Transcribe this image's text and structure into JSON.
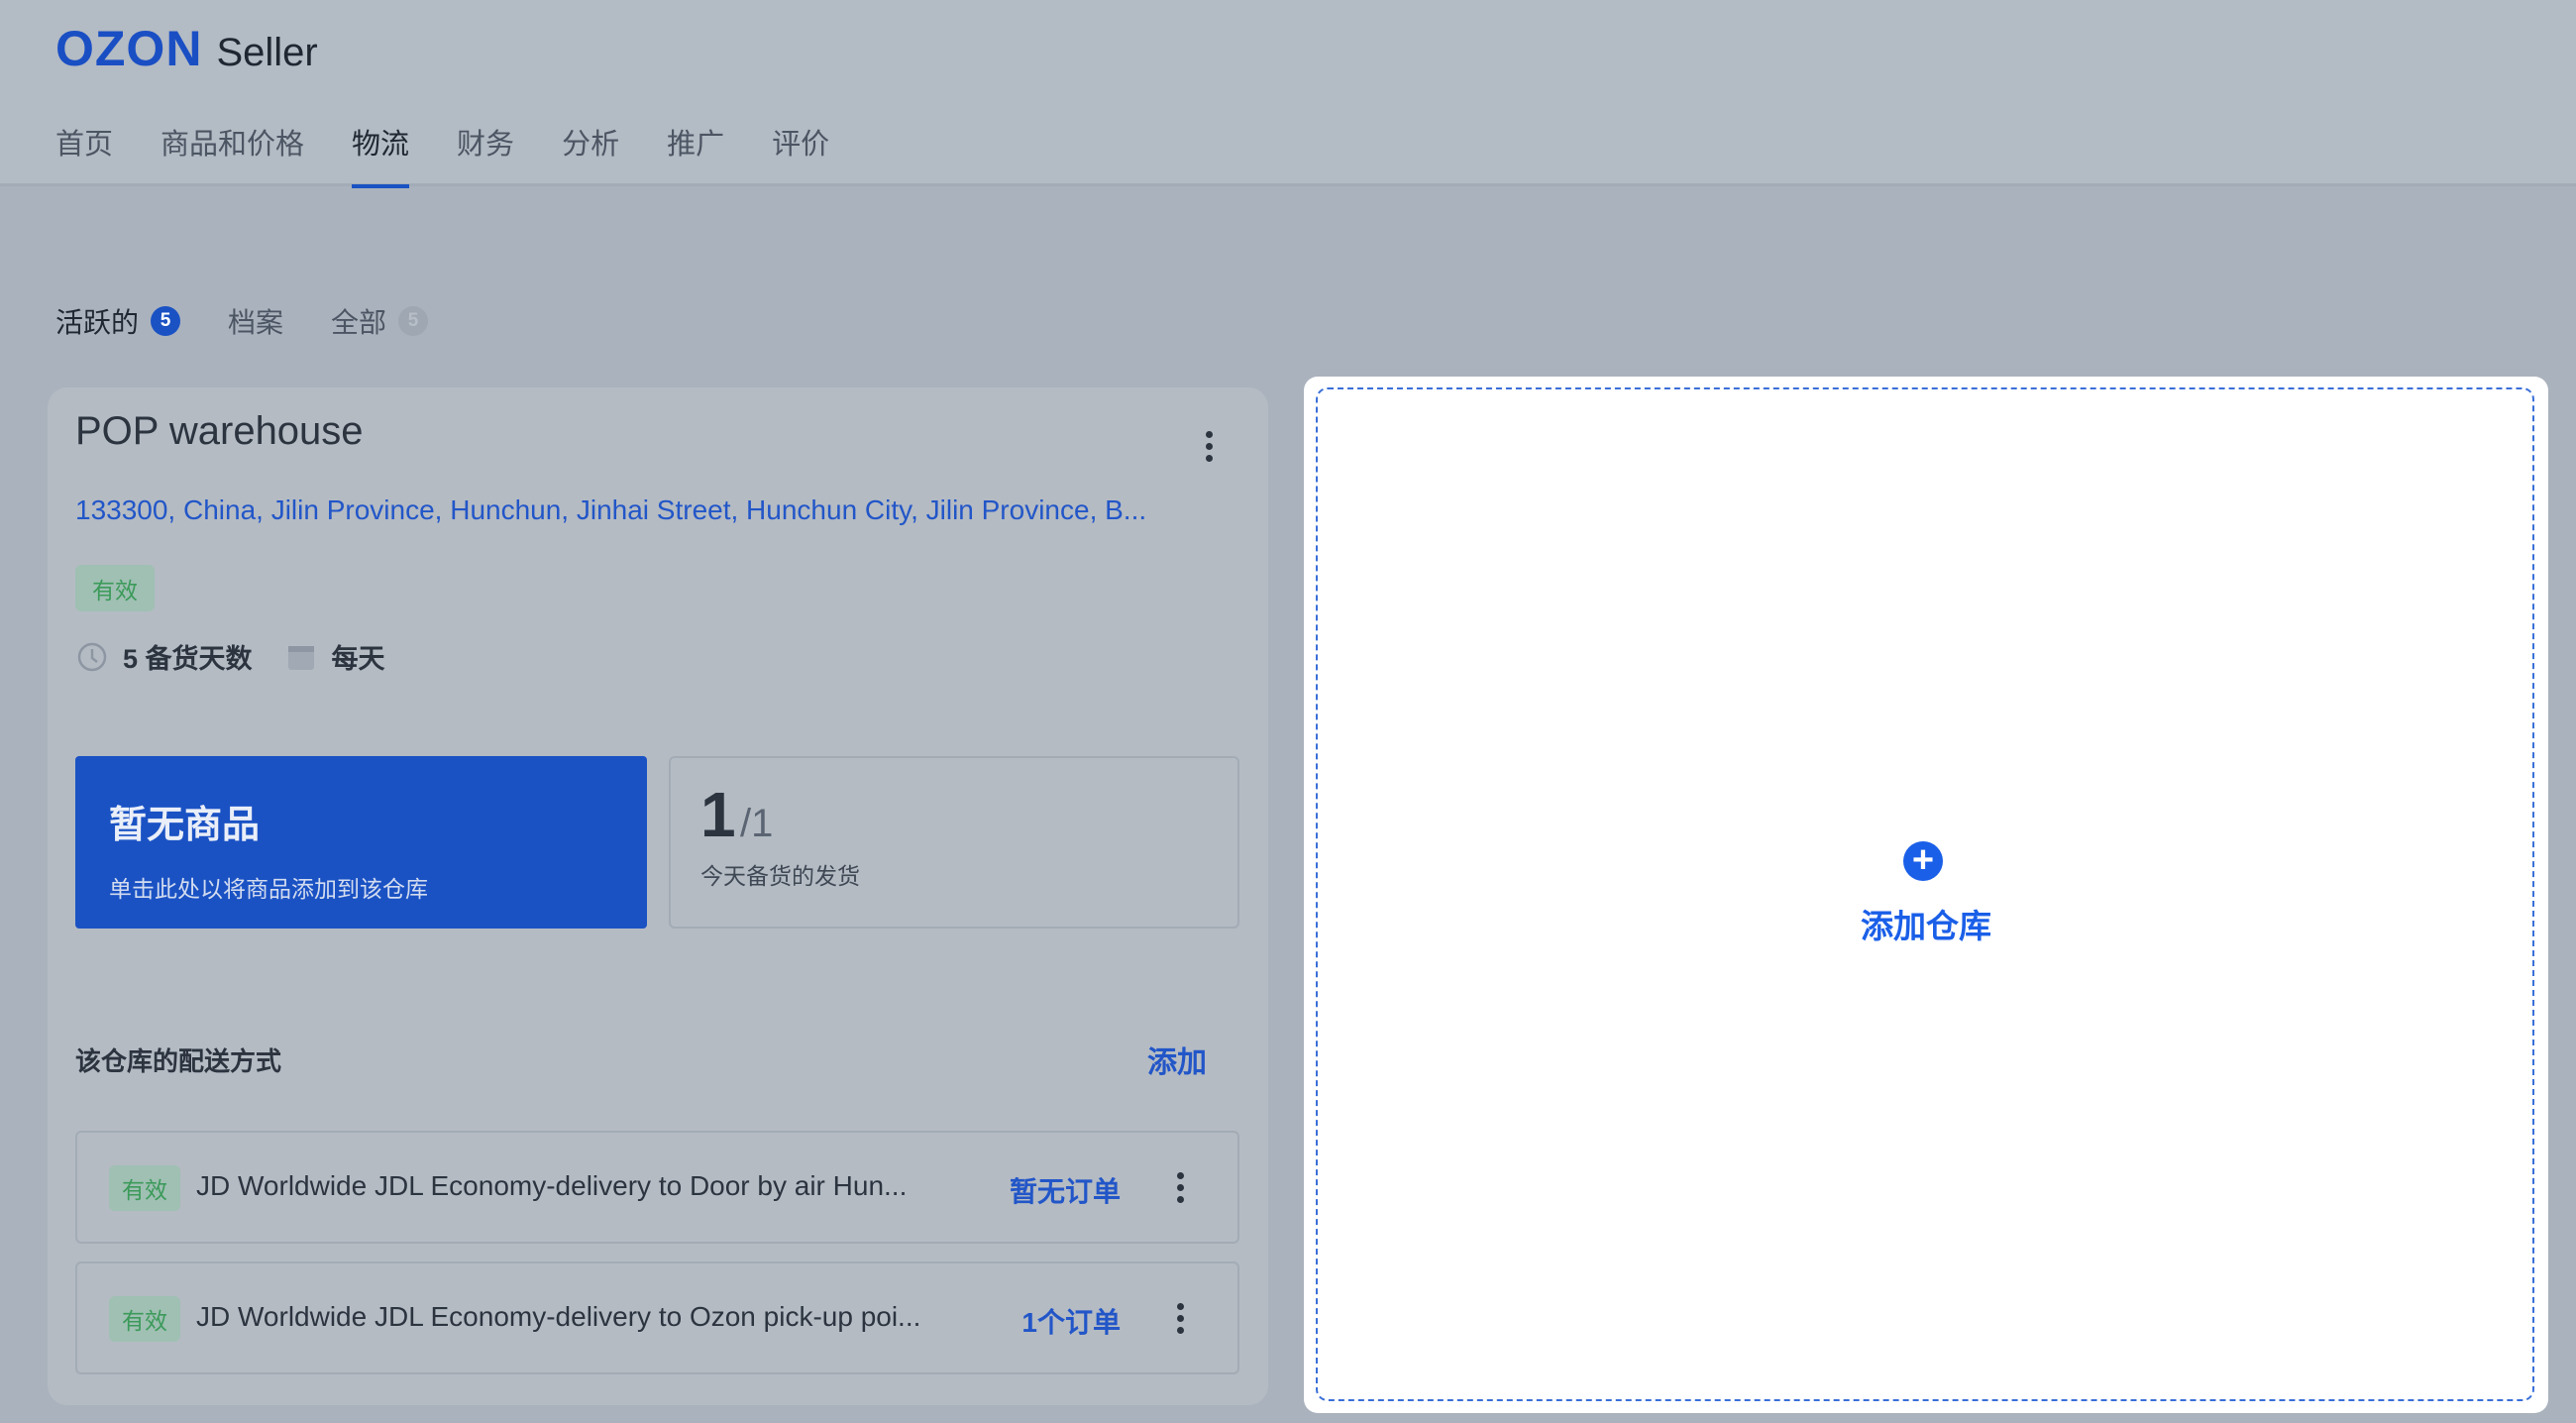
{
  "header": {
    "logo": "OZON",
    "logo_suffix": "Seller",
    "nav": [
      "首页",
      "商品和价格",
      "物流",
      "财务",
      "分析",
      "推广",
      "评价"
    ],
    "active_nav": "物流"
  },
  "subtabs": [
    {
      "label": "活跃的",
      "count": "5"
    },
    {
      "label": "档案"
    },
    {
      "label": "全部",
      "count": "5"
    }
  ],
  "warehouse": {
    "title": "POP warehouse",
    "address": "133300, China, Jilin Province, Hunchun, Jinhai Street, Hunchun City, Jilin Province, B...",
    "status": "有效",
    "prep_days": "5 备货天数",
    "schedule": "每天",
    "no_products_title": "暂无商品",
    "no_products_sub": "单击此处以将商品添加到该仓库",
    "stat_value": "1",
    "stat_total": "/1",
    "stat_label": "今天备货的发货",
    "delivery_title": "该仓库的配送方式",
    "add_label": "添加",
    "delivery_methods": [
      {
        "status": "有效",
        "name": "JD Worldwide JDL Economy-delivery to Door by air Hun...",
        "orders": "暂无订单"
      },
      {
        "status": "有效",
        "name": "JD Worldwide JDL Economy-delivery to Ozon pick-up poi...",
        "orders": "1个订单"
      }
    ]
  },
  "add_warehouse": {
    "label": "添加仓库"
  },
  "colors": {
    "accent": "#1a52c4",
    "link": "#2256c8",
    "success": "#3c9a5a"
  }
}
